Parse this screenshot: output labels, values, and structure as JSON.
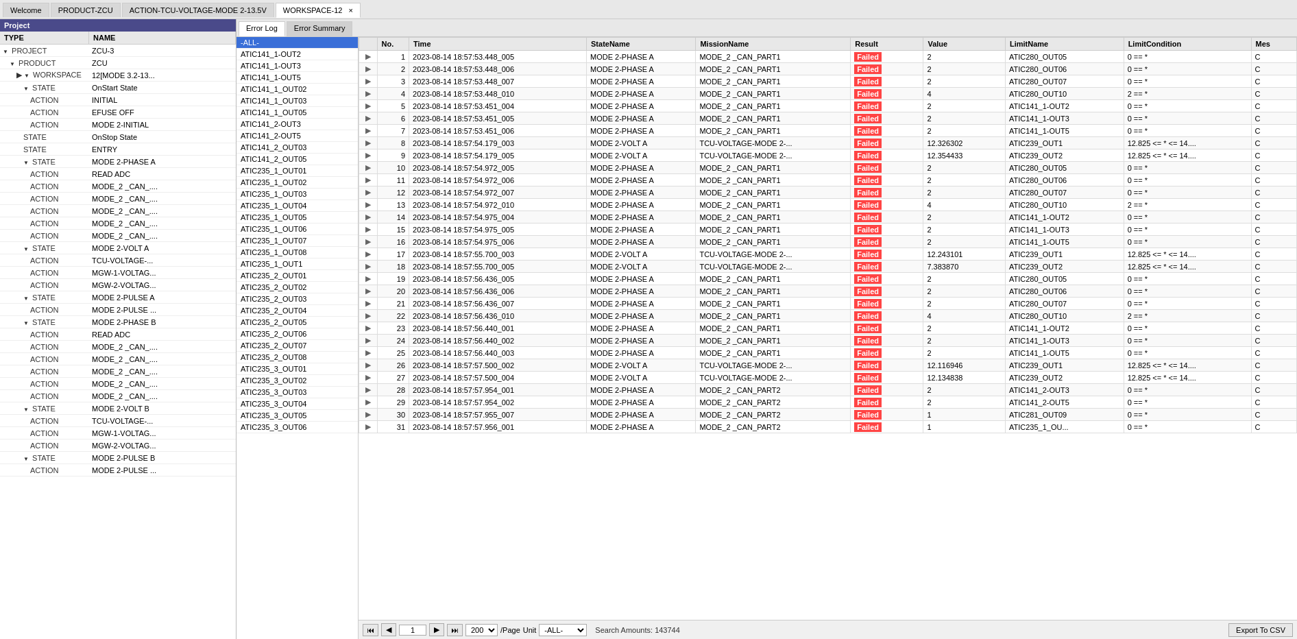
{
  "tabs": {
    "welcome": "Welcome",
    "product_zcu": "PRODUCT-ZCU",
    "action_tcu": "ACTION-TCU-VOLTAGE-MODE 2-13.5V",
    "workspace": "WORKSPACE-12",
    "active_tab": "workspace"
  },
  "project_header": "Project",
  "tree": {
    "columns": [
      "TYPE",
      "NAME"
    ],
    "rows": [
      {
        "indent": 0,
        "expand": "open",
        "type": "PROJECT",
        "name": "ZCU-3"
      },
      {
        "indent": 1,
        "expand": "open",
        "type": "PRODUCT",
        "name": "ZCU"
      },
      {
        "indent": 2,
        "expand": "open",
        "type": "WORKSPACE",
        "name": "12[MODE 3.2-13...",
        "arrow": true
      },
      {
        "indent": 3,
        "expand": "open",
        "type": "STATE",
        "name": "OnStart State"
      },
      {
        "indent": 4,
        "expand": "none",
        "type": "ACTION",
        "name": "INITIAL"
      },
      {
        "indent": 4,
        "expand": "none",
        "type": "ACTION",
        "name": "EFUSE OFF"
      },
      {
        "indent": 4,
        "expand": "none",
        "type": "ACTION",
        "name": "MODE 2-INITIAL"
      },
      {
        "indent": 3,
        "expand": "none",
        "type": "STATE",
        "name": "OnStop State"
      },
      {
        "indent": 3,
        "expand": "none",
        "type": "STATE",
        "name": "ENTRY"
      },
      {
        "indent": 3,
        "expand": "open",
        "type": "STATE",
        "name": "MODE 2-PHASE A"
      },
      {
        "indent": 4,
        "expand": "none",
        "type": "ACTION",
        "name": "READ ADC"
      },
      {
        "indent": 4,
        "expand": "none",
        "type": "ACTION",
        "name": "MODE_2 _CAN_...."
      },
      {
        "indent": 4,
        "expand": "none",
        "type": "ACTION",
        "name": "MODE_2 _CAN_...."
      },
      {
        "indent": 4,
        "expand": "none",
        "type": "ACTION",
        "name": "MODE_2 _CAN_...."
      },
      {
        "indent": 4,
        "expand": "none",
        "type": "ACTION",
        "name": "MODE_2 _CAN_...."
      },
      {
        "indent": 4,
        "expand": "none",
        "type": "ACTION",
        "name": "MODE_2 _CAN_...."
      },
      {
        "indent": 3,
        "expand": "open",
        "type": "STATE",
        "name": "MODE 2-VOLT A"
      },
      {
        "indent": 4,
        "expand": "none",
        "type": "ACTION",
        "name": "TCU-VOLTAGE-..."
      },
      {
        "indent": 4,
        "expand": "none",
        "type": "ACTION",
        "name": "MGW-1-VOLTAG..."
      },
      {
        "indent": 4,
        "expand": "none",
        "type": "ACTION",
        "name": "MGW-2-VOLTAG..."
      },
      {
        "indent": 3,
        "expand": "open",
        "type": "STATE",
        "name": "MODE 2-PULSE A"
      },
      {
        "indent": 4,
        "expand": "none",
        "type": "ACTION",
        "name": "MODE 2-PULSE ..."
      },
      {
        "indent": 3,
        "expand": "open",
        "type": "STATE",
        "name": "MODE 2-PHASE B"
      },
      {
        "indent": 4,
        "expand": "none",
        "type": "ACTION",
        "name": "READ ADC"
      },
      {
        "indent": 4,
        "expand": "none",
        "type": "ACTION",
        "name": "MODE_2 _CAN_...."
      },
      {
        "indent": 4,
        "expand": "none",
        "type": "ACTION",
        "name": "MODE_2 _CAN_...."
      },
      {
        "indent": 4,
        "expand": "none",
        "type": "ACTION",
        "name": "MODE_2 _CAN_...."
      },
      {
        "indent": 4,
        "expand": "none",
        "type": "ACTION",
        "name": "MODE_2 _CAN_...."
      },
      {
        "indent": 4,
        "expand": "none",
        "type": "ACTION",
        "name": "MODE_2 _CAN_...."
      },
      {
        "indent": 3,
        "expand": "open",
        "type": "STATE",
        "name": "MODE 2-VOLT B"
      },
      {
        "indent": 4,
        "expand": "none",
        "type": "ACTION",
        "name": "TCU-VOLTAGE-..."
      },
      {
        "indent": 4,
        "expand": "none",
        "type": "ACTION",
        "name": "MGW-1-VOLTAG..."
      },
      {
        "indent": 4,
        "expand": "none",
        "type": "ACTION",
        "name": "MGW-2-VOLTAG..."
      },
      {
        "indent": 3,
        "expand": "open",
        "type": "STATE",
        "name": "MODE 2-PULSE B"
      },
      {
        "indent": 4,
        "expand": "none",
        "type": "ACTION",
        "name": "MODE 2-PULSE ..."
      }
    ]
  },
  "subtabs": [
    "Error Log",
    "Error Summary"
  ],
  "active_subtab": "Error Log",
  "filter_items": [
    "-ALL-",
    "ATIC141_1-OUT2",
    "ATIC141_1-OUT3",
    "ATIC141_1-OUT5",
    "ATIC141_1_OUT02",
    "ATIC141_1_OUT03",
    "ATIC141_1_OUT05",
    "ATIC141_2-OUT3",
    "ATIC141_2-OUT5",
    "ATIC141_2_OUT03",
    "ATIC141_2_OUT05",
    "ATIC235_1_OUT01",
    "ATIC235_1_OUT02",
    "ATIC235_1_OUT03",
    "ATIC235_1_OUT04",
    "ATIC235_1_OUT05",
    "ATIC235_1_OUT06",
    "ATIC235_1_OUT07",
    "ATIC235_1_OUT08",
    "ATIC235_1_OUT1",
    "ATIC235_2_OUT01",
    "ATIC235_2_OUT02",
    "ATIC235_2_OUT03",
    "ATIC235_2_OUT04",
    "ATIC235_2_OUT05",
    "ATIC235_2_OUT06",
    "ATIC235_2_OUT07",
    "ATIC235_2_OUT08",
    "ATIC235_3_OUT01",
    "ATIC235_3_OUT02",
    "ATIC235_3_OUT03",
    "ATIC235_3_OUT04",
    "ATIC235_3_OUT05",
    "ATIC235_3_OUT06"
  ],
  "table_columns": [
    "",
    "No.",
    "Time",
    "StateName",
    "MissionName",
    "Result",
    "Value",
    "LimitName",
    "LimitCondition",
    "Mes"
  ],
  "table_rows": [
    {
      "no": 1,
      "time": "2023-08-14 18:57:53.448_005",
      "state": "MODE 2-PHASE A",
      "mission": "MODE_2 _CAN_PART1",
      "result": "Failed",
      "value": "2",
      "limit": "ATIC280_OUT05",
      "condition": "0 == *",
      "mes": "C"
    },
    {
      "no": 2,
      "time": "2023-08-14 18:57:53.448_006",
      "state": "MODE 2-PHASE A",
      "mission": "MODE_2 _CAN_PART1",
      "result": "Failed",
      "value": "2",
      "limit": "ATIC280_OUT06",
      "condition": "0 == *",
      "mes": "C"
    },
    {
      "no": 3,
      "time": "2023-08-14 18:57:53.448_007",
      "state": "MODE 2-PHASE A",
      "mission": "MODE_2 _CAN_PART1",
      "result": "Failed",
      "value": "2",
      "limit": "ATIC280_OUT07",
      "condition": "0 == *",
      "mes": "C"
    },
    {
      "no": 4,
      "time": "2023-08-14 18:57:53.448_010",
      "state": "MODE 2-PHASE A",
      "mission": "MODE_2 _CAN_PART1",
      "result": "Failed",
      "value": "4",
      "limit": "ATIC280_OUT10",
      "condition": "2 == *",
      "mes": "C"
    },
    {
      "no": 5,
      "time": "2023-08-14 18:57:53.451_004",
      "state": "MODE 2-PHASE A",
      "mission": "MODE_2 _CAN_PART1",
      "result": "Failed",
      "value": "2",
      "limit": "ATIC141_1-OUT2",
      "condition": "0 == *",
      "mes": "C"
    },
    {
      "no": 6,
      "time": "2023-08-14 18:57:53.451_005",
      "state": "MODE 2-PHASE A",
      "mission": "MODE_2 _CAN_PART1",
      "result": "Failed",
      "value": "2",
      "limit": "ATIC141_1-OUT3",
      "condition": "0 == *",
      "mes": "C"
    },
    {
      "no": 7,
      "time": "2023-08-14 18:57:53.451_006",
      "state": "MODE 2-PHASE A",
      "mission": "MODE_2 _CAN_PART1",
      "result": "Failed",
      "value": "2",
      "limit": "ATIC141_1-OUT5",
      "condition": "0 == *",
      "mes": "C"
    },
    {
      "no": 8,
      "time": "2023-08-14 18:57:54.179_003",
      "state": "MODE 2-VOLT A",
      "mission": "TCU-VOLTAGE-MODE 2-...",
      "result": "Failed",
      "value": "12.326302",
      "limit": "ATIC239_OUT1",
      "condition": "12.825 <= * <= 14....",
      "mes": "C"
    },
    {
      "no": 9,
      "time": "2023-08-14 18:57:54.179_005",
      "state": "MODE 2-VOLT A",
      "mission": "TCU-VOLTAGE-MODE 2-...",
      "result": "Failed",
      "value": "12.354433",
      "limit": "ATIC239_OUT2",
      "condition": "12.825 <= * <= 14....",
      "mes": "C"
    },
    {
      "no": 10,
      "time": "2023-08-14 18:57:54.972_005",
      "state": "MODE 2-PHASE A",
      "mission": "MODE_2 _CAN_PART1",
      "result": "Failed",
      "value": "2",
      "limit": "ATIC280_OUT05",
      "condition": "0 == *",
      "mes": "C"
    },
    {
      "no": 11,
      "time": "2023-08-14 18:57:54.972_006",
      "state": "MODE 2-PHASE A",
      "mission": "MODE_2 _CAN_PART1",
      "result": "Failed",
      "value": "2",
      "limit": "ATIC280_OUT06",
      "condition": "0 == *",
      "mes": "C"
    },
    {
      "no": 12,
      "time": "2023-08-14 18:57:54.972_007",
      "state": "MODE 2-PHASE A",
      "mission": "MODE_2 _CAN_PART1",
      "result": "Failed",
      "value": "2",
      "limit": "ATIC280_OUT07",
      "condition": "0 == *",
      "mes": "C"
    },
    {
      "no": 13,
      "time": "2023-08-14 18:57:54.972_010",
      "state": "MODE 2-PHASE A",
      "mission": "MODE_2 _CAN_PART1",
      "result": "Failed",
      "value": "4",
      "limit": "ATIC280_OUT10",
      "condition": "2 == *",
      "mes": "C"
    },
    {
      "no": 14,
      "time": "2023-08-14 18:57:54.975_004",
      "state": "MODE 2-PHASE A",
      "mission": "MODE_2 _CAN_PART1",
      "result": "Failed",
      "value": "2",
      "limit": "ATIC141_1-OUT2",
      "condition": "0 == *",
      "mes": "C"
    },
    {
      "no": 15,
      "time": "2023-08-14 18:57:54.975_005",
      "state": "MODE 2-PHASE A",
      "mission": "MODE_2 _CAN_PART1",
      "result": "Failed",
      "value": "2",
      "limit": "ATIC141_1-OUT3",
      "condition": "0 == *",
      "mes": "C"
    },
    {
      "no": 16,
      "time": "2023-08-14 18:57:54.975_006",
      "state": "MODE 2-PHASE A",
      "mission": "MODE_2 _CAN_PART1",
      "result": "Failed",
      "value": "2",
      "limit": "ATIC141_1-OUT5",
      "condition": "0 == *",
      "mes": "C"
    },
    {
      "no": 17,
      "time": "2023-08-14 18:57:55.700_003",
      "state": "MODE 2-VOLT A",
      "mission": "TCU-VOLTAGE-MODE 2-...",
      "result": "Failed",
      "value": "12.243101",
      "limit": "ATIC239_OUT1",
      "condition": "12.825 <= * <= 14....",
      "mes": "C"
    },
    {
      "no": 18,
      "time": "2023-08-14 18:57:55.700_005",
      "state": "MODE 2-VOLT A",
      "mission": "TCU-VOLTAGE-MODE 2-...",
      "result": "Failed",
      "value": "7.383870",
      "limit": "ATIC239_OUT2",
      "condition": "12.825 <= * <= 14....",
      "mes": "C"
    },
    {
      "no": 19,
      "time": "2023-08-14 18:57:56.436_005",
      "state": "MODE 2-PHASE A",
      "mission": "MODE_2 _CAN_PART1",
      "result": "Failed",
      "value": "2",
      "limit": "ATIC280_OUT05",
      "condition": "0 == *",
      "mes": "C"
    },
    {
      "no": 20,
      "time": "2023-08-14 18:57:56.436_006",
      "state": "MODE 2-PHASE A",
      "mission": "MODE_2 _CAN_PART1",
      "result": "Failed",
      "value": "2",
      "limit": "ATIC280_OUT06",
      "condition": "0 == *",
      "mes": "C"
    },
    {
      "no": 21,
      "time": "2023-08-14 18:57:56.436_007",
      "state": "MODE 2-PHASE A",
      "mission": "MODE_2 _CAN_PART1",
      "result": "Failed",
      "value": "2",
      "limit": "ATIC280_OUT07",
      "condition": "0 == *",
      "mes": "C"
    },
    {
      "no": 22,
      "time": "2023-08-14 18:57:56.436_010",
      "state": "MODE 2-PHASE A",
      "mission": "MODE_2 _CAN_PART1",
      "result": "Failed",
      "value": "4",
      "limit": "ATIC280_OUT10",
      "condition": "2 == *",
      "mes": "C"
    },
    {
      "no": 23,
      "time": "2023-08-14 18:57:56.440_001",
      "state": "MODE 2-PHASE A",
      "mission": "MODE_2 _CAN_PART1",
      "result": "Failed",
      "value": "2",
      "limit": "ATIC141_1-OUT2",
      "condition": "0 == *",
      "mes": "C"
    },
    {
      "no": 24,
      "time": "2023-08-14 18:57:56.440_002",
      "state": "MODE 2-PHASE A",
      "mission": "MODE_2 _CAN_PART1",
      "result": "Failed",
      "value": "2",
      "limit": "ATIC141_1-OUT3",
      "condition": "0 == *",
      "mes": "C"
    },
    {
      "no": 25,
      "time": "2023-08-14 18:57:56.440_003",
      "state": "MODE 2-PHASE A",
      "mission": "MODE_2 _CAN_PART1",
      "result": "Failed",
      "value": "2",
      "limit": "ATIC141_1-OUT5",
      "condition": "0 == *",
      "mes": "C"
    },
    {
      "no": 26,
      "time": "2023-08-14 18:57:57.500_002",
      "state": "MODE 2-VOLT A",
      "mission": "TCU-VOLTAGE-MODE 2-...",
      "result": "Failed",
      "value": "12.116946",
      "limit": "ATIC239_OUT1",
      "condition": "12.825 <= * <= 14....",
      "mes": "C"
    },
    {
      "no": 27,
      "time": "2023-08-14 18:57:57.500_004",
      "state": "MODE 2-VOLT A",
      "mission": "TCU-VOLTAGE-MODE 2-...",
      "result": "Failed",
      "value": "12.134838",
      "limit": "ATIC239_OUT2",
      "condition": "12.825 <= * <= 14....",
      "mes": "C"
    },
    {
      "no": 28,
      "time": "2023-08-14 18:57:57.954_001",
      "state": "MODE 2-PHASE A",
      "mission": "MODE_2 _CAN_PART2",
      "result": "Failed",
      "value": "2",
      "limit": "ATIC141_2-OUT3",
      "condition": "0 == *",
      "mes": "C"
    },
    {
      "no": 29,
      "time": "2023-08-14 18:57:57.954_002",
      "state": "MODE 2-PHASE A",
      "mission": "MODE_2 _CAN_PART2",
      "result": "Failed",
      "value": "2",
      "limit": "ATIC141_2-OUT5",
      "condition": "0 == *",
      "mes": "C"
    },
    {
      "no": 30,
      "time": "2023-08-14 18:57:57.955_007",
      "state": "MODE 2-PHASE A",
      "mission": "MODE_2 _CAN_PART2",
      "result": "Failed",
      "value": "1",
      "limit": "ATIC281_OUT09",
      "condition": "0 == *",
      "mes": "C"
    },
    {
      "no": 31,
      "time": "2023-08-14 18:57:57.956_001",
      "state": "MODE 2-PHASE A",
      "mission": "MODE_2 _CAN_PART2",
      "result": "Failed",
      "value": "1",
      "limit": "ATIC235_1_OU...",
      "condition": "0 == *",
      "mes": "C"
    }
  ],
  "pagination": {
    "current_page": "1",
    "per_page": "200",
    "unit": "-ALL-",
    "search_amounts": "Search Amounts: 143744",
    "per_page_label": "/Page",
    "unit_label": "Unit",
    "export_label": "Export To CSV"
  },
  "nav_buttons": {
    "first": "⏮",
    "prev": "◀",
    "next": "▶",
    "last": "⏭"
  }
}
